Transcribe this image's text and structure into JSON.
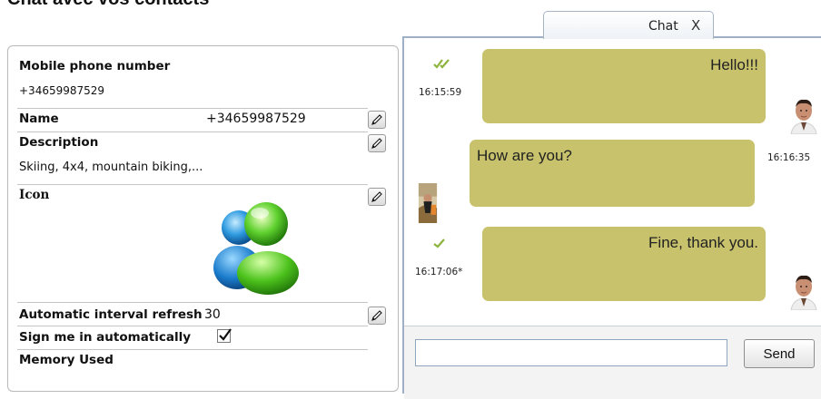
{
  "page": {
    "heading": "Chat avec vos contacts"
  },
  "contact": {
    "mobile": {
      "label": "Mobile phone number",
      "value": "+34659987529"
    },
    "name": {
      "label": "Name",
      "value": "+34659987529"
    },
    "description": {
      "label": "Description",
      "value": "Skiing, 4x4, mountain biking,..."
    },
    "icon": {
      "label": "Icon",
      "icon_name": "messenger-buddies-icon"
    },
    "refresh": {
      "label": "Automatic interval refresh",
      "value": "30"
    },
    "sign_in": {
      "label": "Sign me in automatically",
      "checked": true
    },
    "memory": {
      "label": "Memory Used"
    }
  },
  "chat": {
    "tab": {
      "label": "Chat",
      "close_label": "X"
    },
    "messages": [
      {
        "text": "Hello!!!",
        "time": "16:15:59",
        "status": "double-check"
      },
      {
        "text": "How are you?",
        "time": "16:16:35"
      },
      {
        "text": "Fine, thank you.",
        "time": "16:17:06*",
        "status": "check"
      }
    ],
    "input": {
      "value": "",
      "placeholder": ""
    },
    "send_label": "Send"
  },
  "colors": {
    "bubble": "#c8c26c",
    "tick": "#8cb43c",
    "chat_border": "#9fb0c6",
    "panel_border": "#b9b9b9"
  }
}
